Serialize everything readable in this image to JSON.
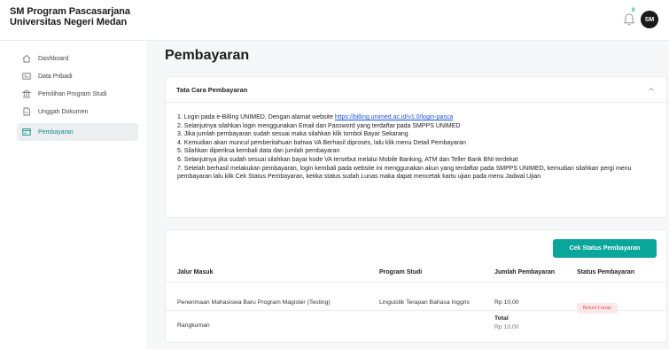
{
  "brand": {
    "line1": "SM Program Pascasarjana",
    "line2": "Universitas Negeri Medan"
  },
  "header": {
    "notif_count": "0",
    "avatar_initials": "SM"
  },
  "sidebar": {
    "items": [
      {
        "label": "Dashboard",
        "icon": "home-icon"
      },
      {
        "label": "Data Pribadi",
        "icon": "id-card-icon"
      },
      {
        "label": "Pemilihan Program Studi",
        "icon": "building-icon"
      },
      {
        "label": "Unggah Dokumen",
        "icon": "document-icon"
      },
      {
        "label": "Pembayaran",
        "icon": "payment-icon",
        "active": true
      }
    ]
  },
  "main": {
    "title": "Pembayaran",
    "tata_cara": {
      "title": "Tata Cara Pembayaran",
      "step1_prefix": "1. Login pada e-Billing UNIMED, Dengan alamat website ",
      "step1_link": "https://billing.unimed.ac.id/v1.0/login-pasca",
      "steps": [
        "2. Selanjutnya silahkan login menggunakan Email dan Password yang terdaftar pada SMPPS UNIMED",
        "3. Jika jumlah pembayaran sudah sesuai maka silahkan klik tombol Bayar Sekarang",
        "4. Kemudian akan muncul pemberitahuan bahwa VA Berhasil diproses, lalu klik menu Detail Pembayaran",
        "5. Silahkan diperiksa kembali data dan jumlah pembayaran",
        "6. Selanjutnya jika sudah sesuai silahkan bayar kode VA tersebut melalui Mobile Banking, ATM dan Teller Bank BNI terdekat",
        "7. Setelah berhasil melakukan pembayaran, login kembali pada website ini menggunakan akun yang terdaftar pada SMPPS UNIMED, kemudian silahkan pergi menu pembayaran lalu klik Cek Status Pembayaran, ketika status sudah Lunas maka dapat mencetak kartu ujian pada menu Jadwal Ujian"
      ]
    },
    "payment": {
      "button_label": "Cek Status Pembayaran",
      "columns": [
        "Jalur Masuk",
        "Program Studi",
        "Jumlah Pembayaran",
        "Status Pembayaran"
      ],
      "row": {
        "jalur": "Penerimaan Mahasiswa Baru Program Magister (Testing)",
        "prodi": "Linguistik Terapan Bahasa Inggris",
        "jumlah": "Rp 10,00",
        "status": "Belum Lunas"
      },
      "summary_label": "Rangkuman",
      "total_label": "Total",
      "total_value": "Rp 10,00"
    }
  },
  "colors": {
    "accent": "#0aa59b",
    "danger": "#e24b4b",
    "link": "#1a56d8"
  }
}
